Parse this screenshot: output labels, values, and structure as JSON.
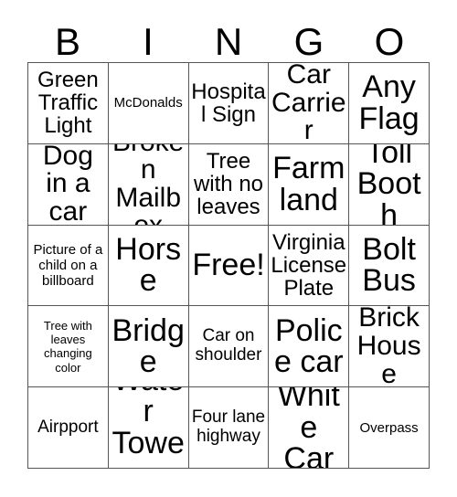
{
  "card": {
    "title_letters": [
      "B",
      "I",
      "N",
      "G",
      "O"
    ],
    "columns": [
      "B",
      "I",
      "N",
      "G",
      "O"
    ],
    "rows": [
      [
        {
          "text": "Green Traffic Light",
          "size": "lg"
        },
        {
          "text": "McDonalds",
          "size": "sm"
        },
        {
          "text": "Hospital Sign",
          "size": "lg"
        },
        {
          "text": "Car Carrier",
          "size": "xl"
        },
        {
          "text": "Any Flag",
          "size": "xxl"
        }
      ],
      [
        {
          "text": "Dog in a car",
          "size": "xl"
        },
        {
          "text": "Broken Mailbox",
          "size": "xl"
        },
        {
          "text": "Tree with no leaves",
          "size": "lg"
        },
        {
          "text": "Farm land",
          "size": "xxl"
        },
        {
          "text": "Toll Booth",
          "size": "xxl"
        }
      ],
      [
        {
          "text": "Picture of a child on a billboard",
          "size": "sm"
        },
        {
          "text": "Horse",
          "size": "xxl"
        },
        {
          "text": "Free!",
          "size": "xxl"
        },
        {
          "text": "Virginia License Plate",
          "size": "lg"
        },
        {
          "text": "Bolt Bus",
          "size": "xxl"
        }
      ],
      [
        {
          "text": "Tree with leaves changing color",
          "size": "xs"
        },
        {
          "text": "Bridge",
          "size": "xxl"
        },
        {
          "text": "Car on shoulder",
          "size": "md"
        },
        {
          "text": "Police car",
          "size": "xxl"
        },
        {
          "text": "Brick House",
          "size": "xl"
        }
      ],
      [
        {
          "text": "Airpport",
          "size": "md"
        },
        {
          "text": "Water Tower",
          "size": "xxl"
        },
        {
          "text": "Four lane highway",
          "size": "md"
        },
        {
          "text": "White Car",
          "size": "xxl"
        },
        {
          "text": "Overpass",
          "size": "sm"
        }
      ]
    ]
  },
  "colors": {
    "background": "#ffffff",
    "text": "#000000",
    "grid_line": "#555555"
  }
}
